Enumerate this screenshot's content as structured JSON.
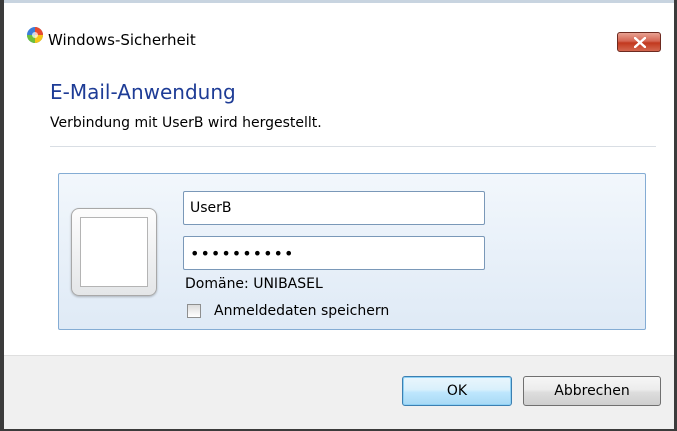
{
  "window": {
    "title": "Windows-Sicherheit",
    "title_icon": "security-shield-icon",
    "close_icon": "close-icon",
    "close_color": "#c2391f"
  },
  "dialog": {
    "heading": "E-Mail-Anwendung",
    "subheading": "Verbindung mit UserB wird hergestellt.",
    "heading_color": "#1e3c96"
  },
  "credentials": {
    "user_tile_icon": "user-tile-icon",
    "username_value": "UserB",
    "password_masked": "••••••••••",
    "domain_text": "Domäne: UNIBASEL",
    "remember_label": "Anmeldedaten speichern",
    "remember_checked": false
  },
  "buttons": {
    "ok_label": "OK",
    "cancel_label": "Abbrechen"
  }
}
